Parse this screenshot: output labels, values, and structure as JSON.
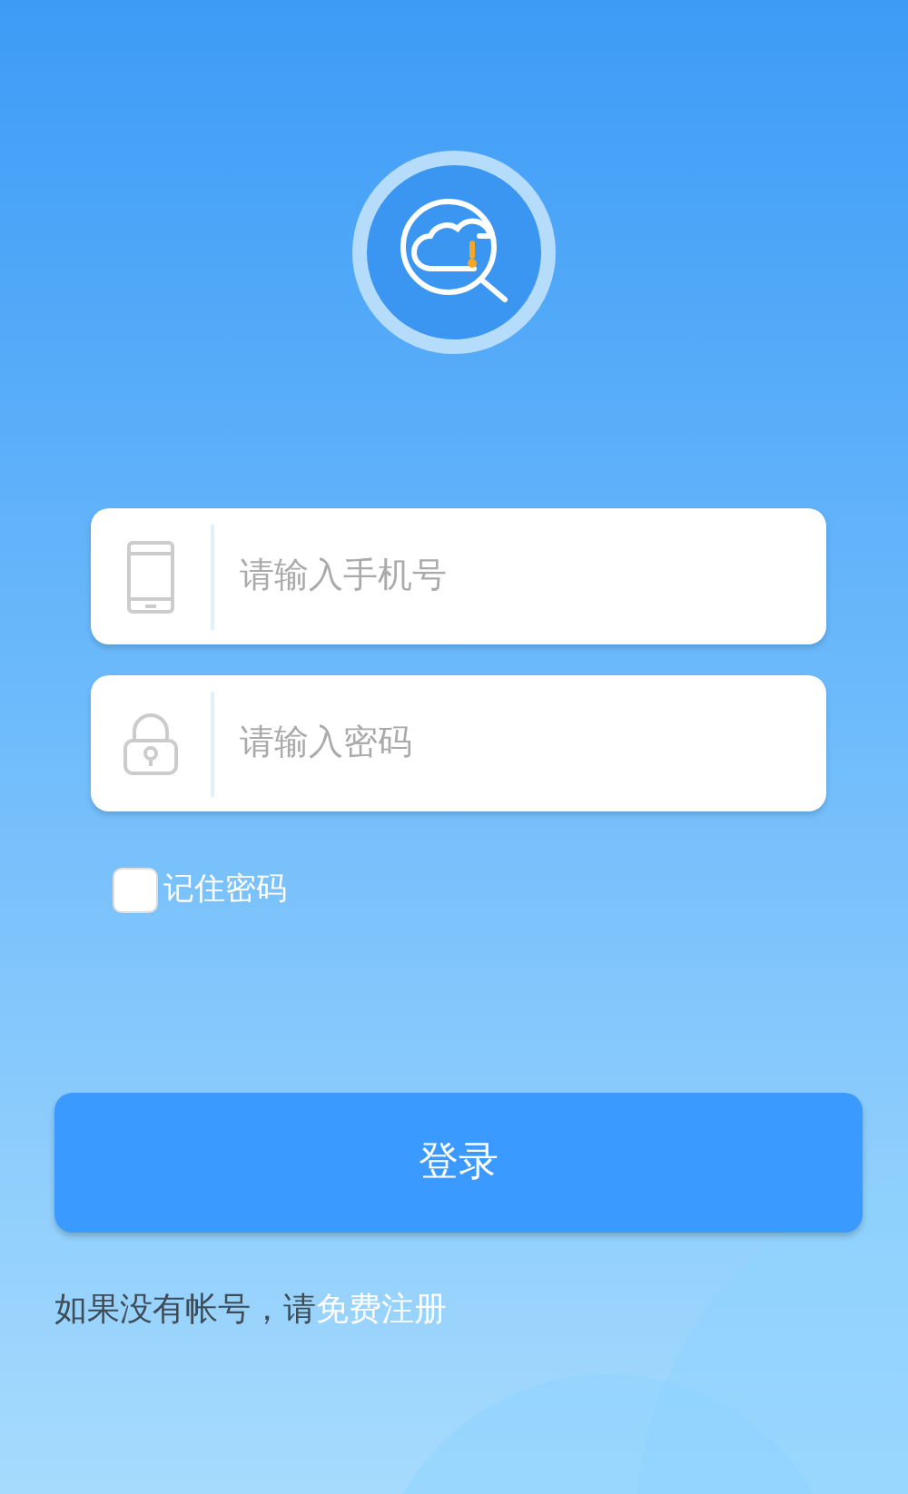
{
  "fields": [
    {
      "kind": "phone",
      "placeholder": "请输入手机号"
    },
    {
      "kind": "password",
      "placeholder": "请输入密码"
    }
  ],
  "remember": {
    "label": "记住密码",
    "checked": false
  },
  "login_button": "登录",
  "register": {
    "prompt": "如果没有帐号，请",
    "link": "免费注册"
  }
}
